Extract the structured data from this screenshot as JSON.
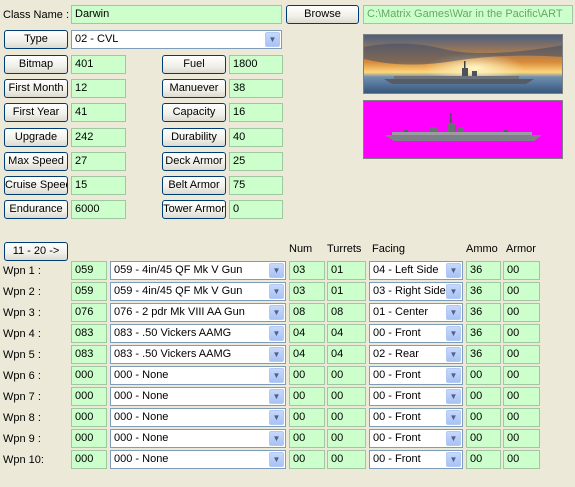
{
  "class_name": {
    "label": "Class Name :",
    "value": "Darwin"
  },
  "browse": {
    "label": "Browse",
    "path": "C:\\Matrix Games\\War in the Pacific\\ART"
  },
  "type": {
    "button": "Type",
    "value": "02 -  CVL"
  },
  "left_fields": [
    {
      "button": "Bitmap",
      "value": "401"
    },
    {
      "button": "First Month",
      "value": "12"
    },
    {
      "button": "First Year",
      "value": "41"
    },
    {
      "button": "Upgrade",
      "value": "242"
    },
    {
      "button": "Max Speed",
      "value": "27"
    },
    {
      "button": "Cruise Speed",
      "value": "15"
    },
    {
      "button": "Endurance",
      "value": "6000"
    }
  ],
  "right_fields": [
    {
      "button": "Fuel",
      "value": "1800"
    },
    {
      "button": "Manuever",
      "value": "38"
    },
    {
      "button": "Capacity",
      "value": "16"
    },
    {
      "button": "Durability",
      "value": "40"
    },
    {
      "button": "Deck Armor",
      "value": "25"
    },
    {
      "button": "Belt Armor",
      "value": "75"
    },
    {
      "button": "Tower Armor",
      "value": "0"
    }
  ],
  "page_button": "11 - 20 ->",
  "headers": {
    "num": "Num",
    "turrets": "Turrets",
    "facing": "Facing",
    "ammo": "Ammo",
    "armor": "Armor"
  },
  "weapons": [
    {
      "label": "Wpn 1 :",
      "id": "059",
      "weapon": "059 - 4in/45 QF Mk V Gun",
      "num": "03",
      "turrets": "01",
      "facing": "04 - Left Side",
      "ammo": "36",
      "armor": "00"
    },
    {
      "label": "Wpn 2 :",
      "id": "059",
      "weapon": "059 - 4in/45 QF Mk V Gun",
      "num": "03",
      "turrets": "01",
      "facing": "03 - Right Side",
      "ammo": "36",
      "armor": "00"
    },
    {
      "label": "Wpn 3 :",
      "id": "076",
      "weapon": "076 - 2 pdr Mk VIII AA Gun",
      "num": "08",
      "turrets": "08",
      "facing": "01 - Center",
      "ammo": "36",
      "armor": "00"
    },
    {
      "label": "Wpn 4 :",
      "id": "083",
      "weapon": "083 - .50 Vickers AAMG",
      "num": "04",
      "turrets": "04",
      "facing": "00 - Front",
      "ammo": "36",
      "armor": "00"
    },
    {
      "label": "Wpn 5 :",
      "id": "083",
      "weapon": "083 - .50 Vickers AAMG",
      "num": "04",
      "turrets": "04",
      "facing": "02 - Rear",
      "ammo": "36",
      "armor": "00"
    },
    {
      "label": "Wpn 6 :",
      "id": "000",
      "weapon": "000 - None",
      "num": "00",
      "turrets": "00",
      "facing": "00 - Front",
      "ammo": "00",
      "armor": "00"
    },
    {
      "label": "Wpn 7 :",
      "id": "000",
      "weapon": "000 - None",
      "num": "00",
      "turrets": "00",
      "facing": "00 - Front",
      "ammo": "00",
      "armor": "00"
    },
    {
      "label": "Wpn 8 :",
      "id": "000",
      "weapon": "000 - None",
      "num": "00",
      "turrets": "00",
      "facing": "00 - Front",
      "ammo": "00",
      "armor": "00"
    },
    {
      "label": "Wpn 9 :",
      "id": "000",
      "weapon": "000 - None",
      "num": "00",
      "turrets": "00",
      "facing": "00 - Front",
      "ammo": "00",
      "armor": "00"
    },
    {
      "label": "Wpn 10:",
      "id": "000",
      "weapon": "000 - None",
      "num": "00",
      "turrets": "00",
      "facing": "00 - Front",
      "ammo": "00",
      "armor": "00"
    }
  ],
  "colors": {
    "field_bg": "#ccffcc",
    "magenta": "#ff00ff",
    "window_bg": "#ece9d8"
  },
  "icons": {
    "dropdown": "chevron-down-icon"
  }
}
